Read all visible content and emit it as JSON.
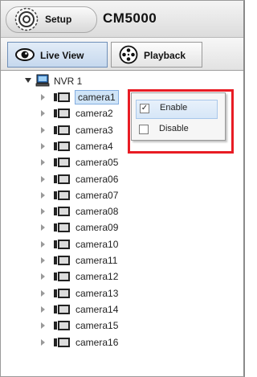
{
  "header": {
    "setup_label": "Setup",
    "title": "CM5000"
  },
  "toolbar": {
    "tabs": [
      {
        "label": "Live View",
        "active": true
      },
      {
        "label": "Playback",
        "active": false
      }
    ]
  },
  "tree": {
    "root_label": "NVR 1",
    "cameras": [
      "camera1",
      "camera2",
      "camera3",
      "camera4",
      "camera05",
      "camera06",
      "camera07",
      "camera08",
      "camera09",
      "camera10",
      "camera11",
      "camera12",
      "camera13",
      "camera14",
      "camera15",
      "camera16"
    ],
    "selected": "camera1"
  },
  "context_menu": {
    "items": [
      {
        "label": "Enable",
        "checked": true
      },
      {
        "label": "Disable",
        "checked": false
      }
    ],
    "highlight_color": "#e81c24"
  }
}
